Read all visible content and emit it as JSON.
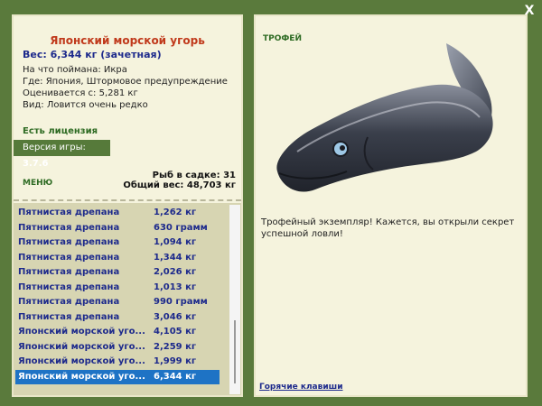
{
  "window": {
    "close_symbol": "X"
  },
  "fish": {
    "title": "Японский морской угорь",
    "weight_line": "Вес: 6,344 кг (зачетная)",
    "bait": "На что поймана: Икра",
    "location": "Где: Япония, Штормовое предупреждение",
    "value": "Оценивается с: 5,281 кг",
    "rarity": "Вид: Ловится очень редко"
  },
  "license": "Есть лицензия",
  "version": {
    "label": "Версия игры:",
    "number": "3.7.6"
  },
  "menu": {
    "label": "МЕНЮ"
  },
  "summary": {
    "fish_count": "Рыб в садке: 31",
    "total_weight": "Общий вес: 48,703 кг"
  },
  "catch_list": [
    {
      "name": "Пятнистая дрепана",
      "weight": "1,262 кг",
      "selected": false
    },
    {
      "name": "Пятнистая дрепана",
      "weight": "630 грамм",
      "selected": false
    },
    {
      "name": "Пятнистая дрепана",
      "weight": "1,094 кг",
      "selected": false
    },
    {
      "name": "Пятнистая дрепана",
      "weight": "1,344 кг",
      "selected": false
    },
    {
      "name": "Пятнистая дрепана",
      "weight": "2,026 кг",
      "selected": false
    },
    {
      "name": "Пятнистая дрепана",
      "weight": "1,013 кг",
      "selected": false
    },
    {
      "name": "Пятнистая дрепана",
      "weight": "990 грамм",
      "selected": false
    },
    {
      "name": "Пятнистая дрепана",
      "weight": "3,046 кг",
      "selected": false
    },
    {
      "name": "Японский морской уго...",
      "weight": "4,105 кг",
      "selected": false
    },
    {
      "name": "Японский морской уго...",
      "weight": "2,259 кг",
      "selected": false
    },
    {
      "name": "Японский морской уго...",
      "weight": "1,999 кг",
      "selected": false
    },
    {
      "name": "Японский морской уго...",
      "weight": "6,344 кг",
      "selected": true
    }
  ],
  "trophy": {
    "label": "ТРОФЕЙ",
    "text": "Трофейный экземпляр! Кажется, вы открыли секрет успешной ловли!",
    "image_icon": "eel-trophy-image"
  },
  "hotkeys_label": "Горячие клавиши",
  "colors": {
    "background": "#5a7a3c",
    "panel": "#f5f3dd",
    "title_red": "#c0391b",
    "text_blue": "#1d2a8c",
    "green_label": "#2e6b23",
    "selected_row": "#1e73c5"
  }
}
